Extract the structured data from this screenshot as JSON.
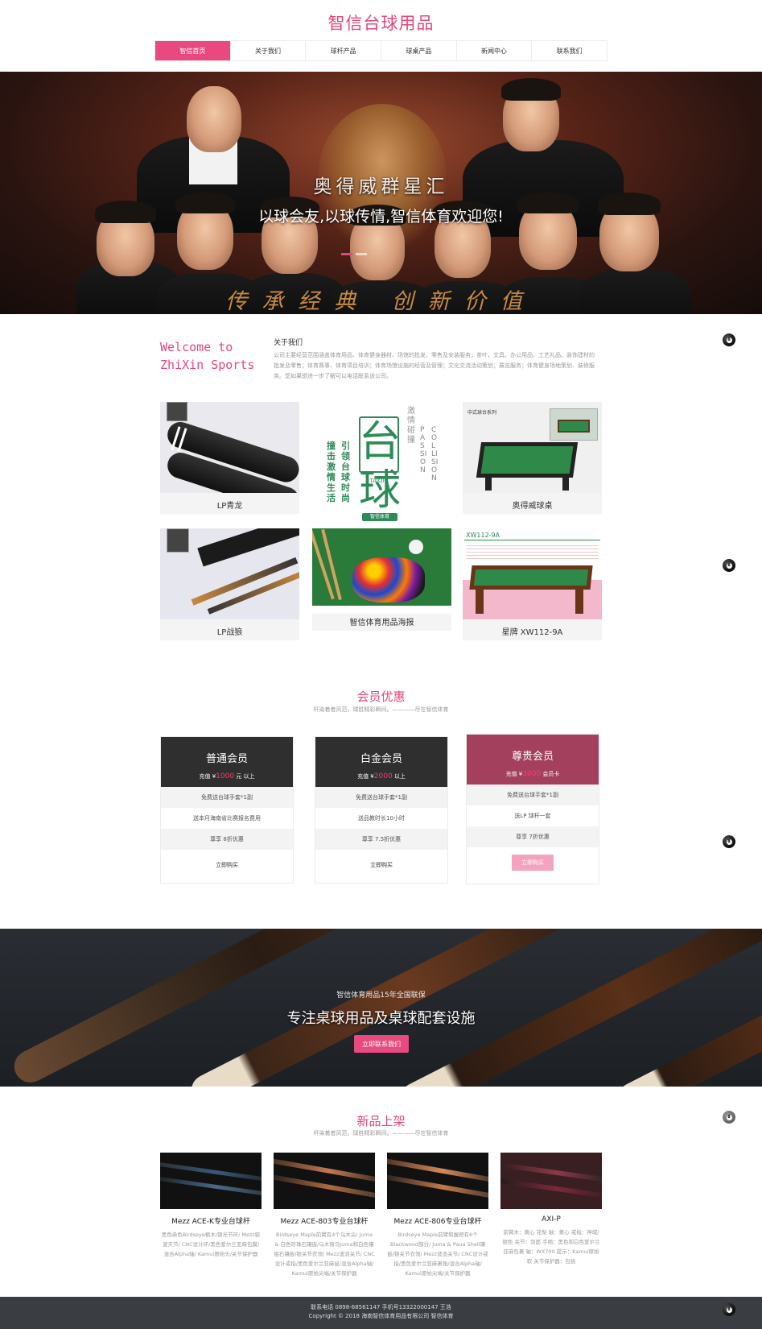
{
  "header": {
    "title": "智信台球用品",
    "nav": [
      "智信首页",
      "关于我们",
      "球杆产品",
      "球桌产品",
      "新闻中心",
      "联系我们"
    ]
  },
  "hero": {
    "title": "奥得威群星汇",
    "subtitle": "以球会友,以球传情,智信体育欢迎您!",
    "slogan": "传承经典 创新价值"
  },
  "about": {
    "welcome": "Welcome to ZhiXin Sports",
    "heading": "关于我们",
    "text": "公司主要经营范围涵盖体育用品、体育健身器材、场馆的批发、零售及安装服务；茶叶、文具、办公用品、工艺礼品、装饰建材的批发及零售；体育赛事、体育项目培训；体育场馆设施的经营及管理；文化交流活动策划；展览服务；体育健身场地策划、装修服务。您如果想进一步了解可以电话联系该公司。"
  },
  "poster": {
    "big": "台球",
    "pinyin": "TAIQIU",
    "en1": "PASSION",
    "en2": "COLLISION",
    "cn_right": "激情碰撞",
    "col1": "撞击激情生活",
    "col2": "引领台球时尚",
    "badge": "智信体育"
  },
  "table_label": "中式球台系列",
  "products": [
    {
      "caption": "LP青龙"
    },
    {
      "caption": ""
    },
    {
      "caption": "奥得威球桌"
    },
    {
      "caption": "LP战狼"
    },
    {
      "caption": "智信体育用品海报"
    },
    {
      "caption": "星牌 XW112-9A"
    }
  ],
  "xw_tag": "XW112-9A",
  "member": {
    "title": "会员优惠",
    "subtitle": "杆染着者风范，球胜精彩瞬间。————尽在智信体育",
    "cards": [
      {
        "name": "普通会员",
        "prefix": "充值 ¥",
        "amount": "1000",
        "suffix": " 元 以上",
        "rows": [
          "免费送台球手套*1副",
          "送本月海南省比赛报名费用",
          "尊享 8折优惠"
        ],
        "buy": "立即购买"
      },
      {
        "name": "白金会员",
        "prefix": "充值 ¥",
        "amount": "2000",
        "suffix": " 以上",
        "rows": [
          "免费送台球手套*1副",
          "送品教时长10小时",
          "尊享 7.5折优惠"
        ],
        "buy": "立即购买"
      },
      {
        "name": "尊贵会员",
        "prefix": "充值 ¥",
        "amount": "3000",
        "suffix": " 会员卡",
        "rows": [
          "免费送台球手套*1副",
          "送LP 球杆一套",
          "尊享 7折优惠"
        ],
        "buy": "立即购买"
      }
    ]
  },
  "banner": {
    "subtitle": "智信体育用品15年全国联保",
    "title": "专注桌球用品及桌球配套设施",
    "button": "立即联系我们"
  },
  "newproducts": {
    "title": "新品上架",
    "subtitle": "杆染着者风范，球胜精彩瞬间。————尽在智信体育",
    "items": [
      {
        "name": "Mezz ACE-K专业台球杆",
        "desc": "黑色染色Birdseye枫木/银光节环/ Mezz驱波天节/ CNC设计环/黑色爱尔兰亚麻包膜/混合Alpha轴/ Kamui原始头/关节保护器"
      },
      {
        "name": "Mezz ACE-803专业台球杆",
        "desc": "Birdseye Maple前臂有4个乌木尖/ Juma & 白色珍珠石镶嵌/乌木铸马juma和白色镶组石镶嵌/银关节衣领/ Mezz波浪关节/ CNC设计戒指/黑色爱尔兰亚麻鼠/混合Alpha轴/ Kamui原始尖端/关节保护器"
      },
      {
        "name": "Mezz ACE-806专业台球杆",
        "desc": "Birdseye Maple前臂和握把有6个Blackwood部分/ Juma & Paua Shell镶嵌/银关节衣领/ Mezz波浪关节/ CNC设计戒指/黑色爱尔兰亚麻裹角/混合Alpha轴/ Kamui原始尖端/关节保护器"
      },
      {
        "name": "AXI-P",
        "desc": "前臂木：黄心 花梨 轴：黄心 戒指：神域/ 银色 关节：剑面 手柄：黑色和白色爱尔兰亚麻包裹 轴：WX700 提示：Kamui原始 软 关节保护器：包括"
      }
    ]
  },
  "footer": {
    "line1": "联系电话 0898-68561147    手机号13322000147 王浩",
    "line2": "Copyright © 2018 海南智信体育用品有限公司    智信体育"
  },
  "colors": {
    "accent": "#e84a7f",
    "dark": "#2f2f2f",
    "vip": "#a2405e"
  }
}
